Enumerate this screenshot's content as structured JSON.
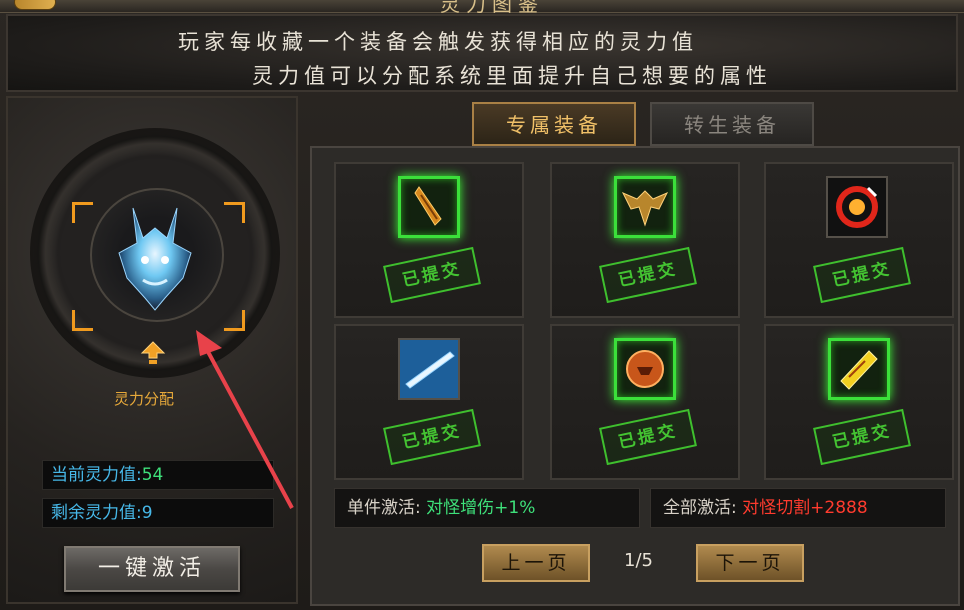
{
  "header": {
    "title": "灵力图鉴"
  },
  "banner": {
    "line1": "玩家每收藏一个装备会触发获得相应的灵力值",
    "line2": "灵力值可以分配系统里面提升自己想要的属性"
  },
  "left": {
    "alloc_label": "灵力分配",
    "current_label": "当前灵力值:",
    "current_value": "54",
    "remaining_label": "剩余灵力值:",
    "remaining_value": "9",
    "activate_all_button": "一键激活"
  },
  "tabs": [
    {
      "label": "专属装备",
      "active": true
    },
    {
      "label": "转生装备",
      "active": false
    }
  ],
  "items": [
    {
      "icon": "feather-scroll-icon",
      "submitted": true,
      "stamp": "已提交"
    },
    {
      "icon": "winged-armor-icon",
      "submitted": true,
      "stamp": "已提交"
    },
    {
      "icon": "flame-ring-icon",
      "submitted": true,
      "stamp": "已提交"
    },
    {
      "icon": "ice-blade-icon",
      "submitted": true,
      "stamp": "已提交"
    },
    {
      "icon": "amber-medallion-icon",
      "submitted": true,
      "stamp": "已提交"
    },
    {
      "icon": "golden-talisman-icon",
      "submitted": true,
      "stamp": "已提交"
    }
  ],
  "info": {
    "single_label": "单件激活:",
    "single_value": "对怪增伤+1%",
    "all_label": "全部激活:",
    "all_value": "对怪切割+2888"
  },
  "pagination": {
    "prev": "上一页",
    "next": "下一页",
    "page": "1/5"
  },
  "colors": {
    "accent_orange": "#f09a1e",
    "green": "#3ee07a",
    "red": "#ff3b2e",
    "blue": "#47b8e8"
  }
}
